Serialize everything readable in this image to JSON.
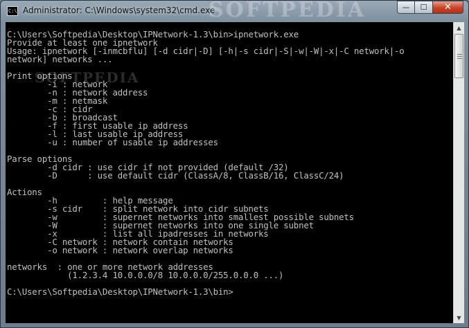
{
  "window": {
    "title": "Administrator: C:\\Windows\\system32\\cmd.exe",
    "icon": "cmd-icon",
    "icon_text": "C:\\",
    "watermark": "SOFTPEDIA",
    "buttons": {
      "minimize": "—",
      "maximize": "☐",
      "close": "✕"
    }
  },
  "console": {
    "watermark": "SOFTPEDIA",
    "lines": [
      "C:\\Users\\Softpedia\\Desktop\\IPNetwork-1.3\\bin>ipnetwork.exe",
      "Provide at least one ipnetwork",
      "Usage: ipnetwork [-inmcbflu] [-d cidr|-D] [-h|-s cidr|-S|-w|-W|-x|-C network|-o",
      "network] networks ...",
      "",
      "Print options",
      "        -i : network",
      "        -n : network address",
      "        -m : netmask",
      "        -c : cidr",
      "        -b : broadcast",
      "        -f : first usable ip address",
      "        -l : last usable ip address",
      "        -u : number of usable ip addresses",
      "",
      "Parse options",
      "        -d cidr : use cidr if not provided (default /32)",
      "        -D      : use default cidr (ClassA/8, ClassB/16, ClassC/24)",
      "",
      "Actions",
      "        -h         : help message",
      "        -s cidr    : split network into cidr subnets",
      "        -w         : supernet networks into smallest possible subnets",
      "        -W         : supernet networks into one single subnet",
      "        -x         : list all ipadresses in networks",
      "        -C network : network contain networks",
      "        -o network : network overlap networks",
      "",
      "networks  : one or more network addresses",
      "            (1.2.3.4 10.0.0.0/8 10.0.0.0/255.0.0.0 ...)",
      "",
      "C:\\Users\\Softpedia\\Desktop\\IPNetwork-1.3\\bin>"
    ]
  },
  "scrollbar": {
    "up_arrow": "▲",
    "down_arrow": "▼"
  }
}
